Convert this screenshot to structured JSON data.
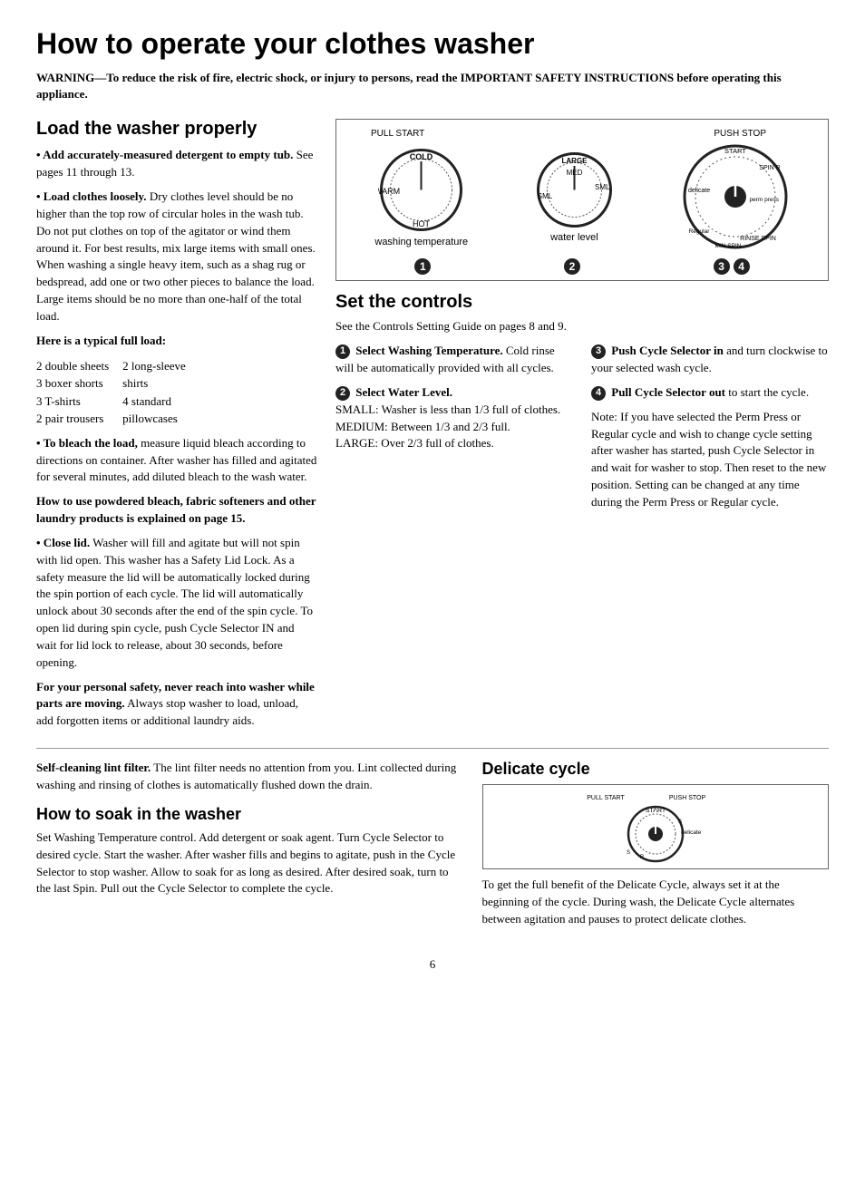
{
  "page": {
    "title": "How to operate your clothes washer",
    "number": "6",
    "warning": "WARNING—To reduce the risk of fire, electric shock, or injury to persons, read the IMPORTANT SAFETY INSTRUCTIONS before operating this appliance."
  },
  "left_section": {
    "title": "Load the washer properly",
    "paragraphs": [
      "• Add accurately-measured detergent to empty tub. See pages 11 through 13.",
      "• Load clothes loosely. Dry clothes level should be no higher than the top row of circular holes in the wash tub. Do not put clothes on top of the agitator or wind them around it. For best results, mix large items with small ones. When washing a single heavy item, such as a shag rug or bedspread, add one or two other pieces to balance the load. Large items should be no more than one-half of the total load.",
      "• To bleach the load, measure liquid bleach according to directions on container. After washer has filled and agitated for several minutes, add diluted bleach to the wash water.",
      "• Close lid. Washer will fill and agitate but will not spin with lid open. This washer has a Safety Lid Lock. As a safety measure the lid will be automatically locked during the spin portion of each cycle. The lid will automatically unlock about 30 seconds after the end of the spin cycle. To open lid during spin cycle, push Cycle Selector IN and wait for lid lock to release, about 30 seconds, before opening.",
      "For your personal safety, never reach into washer while parts are moving. Always stop washer to load, unload, add forgotten items or additional laundry aids."
    ],
    "typical_load_title": "Here is a typical full load:",
    "typical_load": [
      [
        "2 double sheets",
        "2 long-sleeve"
      ],
      [
        "3 boxer shorts",
        "shirts"
      ],
      [
        "3 T-shirts",
        "4 standard"
      ],
      [
        "2 pair trousers",
        "pillowcases"
      ]
    ],
    "bleach_bold": "How to use powdered bleach, fabric softeners and other laundry products is explained on page 15."
  },
  "diagram": {
    "labels_top_left": "PULL START",
    "labels_top_right": "PUSH STOP",
    "dial1_caption": "washing temperature",
    "dial2_caption": "water level",
    "dial3_caption": "",
    "dial4_caption": "",
    "temp_labels": [
      "COLD",
      "WARM"
    ],
    "water_labels": [
      "LARGE",
      "MED",
      "SML"
    ],
    "cycle_labels": [
      "START",
      "SPIN R",
      "perm press",
      "RINSE SPIN",
      "MIN SPIN",
      "Regular",
      "delicate"
    ]
  },
  "controls": {
    "title": "Set the controls",
    "intro": "See the Controls Setting Guide on pages 8 and 9.",
    "step1_title": "Select Washing Temperature.",
    "step1_text": "Cold rinse will be automatically provided with all cycles.",
    "step2_title": "Select Water Level.",
    "step2_small": "SMALL: Washer is less than 1/3 full of clothes.",
    "step2_medium": "MEDIUM: Between 1/3 and 2/3 full.",
    "step2_large": "LARGE: Over 2/3 full of clothes.",
    "step3_title": "Push Cycle Selector in",
    "step3_text": "and turn clockwise to your selected wash cycle.",
    "step4_title": "Pull Cycle Selector out",
    "step4_text": "to start the cycle.",
    "note": "Note: If you have selected the Perm Press or Regular cycle and wish to change cycle setting after washer has started, push Cycle Selector in and wait for washer to stop. Then reset to the new position. Setting can be changed at any time during the Perm Press or Regular cycle."
  },
  "lower": {
    "lint_title": "Self-cleaning lint filter.",
    "lint_text": "The lint filter needs no attention from you. Lint collected during washing and rinsing of clothes is automatically flushed down the drain.",
    "soak_title": "How to soak in the washer",
    "soak_text": "Set Washing Temperature control. Add detergent or soak agent. Turn Cycle Selector to desired cycle. Start the washer. After washer fills and begins to agitate, push in the Cycle Selector to stop washer. Allow to soak for as long as desired. After desired soak, turn to the last Spin. Pull out the Cycle Selector to complete the cycle.",
    "delicate_title": "Delicate cycle",
    "delicate_text": "To get the full benefit of the Delicate Cycle, always set it at the beginning of the cycle. During wash, the Delicate Cycle alternates between agitation and pauses to protect delicate clothes."
  }
}
